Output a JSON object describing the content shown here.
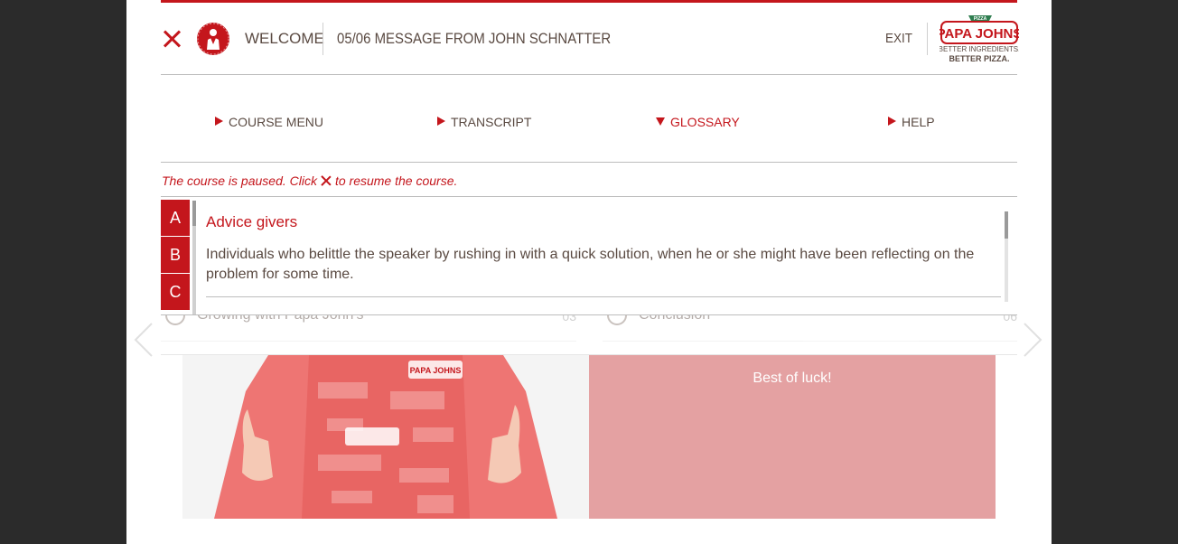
{
  "header": {
    "section_label": "WELCOME",
    "lesson_title": "05/06  MESSAGE FROM JOHN SCHNATTER",
    "exit_label": "EXIT",
    "logo": {
      "line1": "PAPA JOHNS",
      "line2": "BETTER INGREDIENTS.",
      "line3": "BETTER PIZZA.",
      "badge": "PIZZA"
    }
  },
  "nav": {
    "items": [
      {
        "label": "COURSE MENU",
        "state": "collapsed"
      },
      {
        "label": "TRANSCRIPT",
        "state": "collapsed"
      },
      {
        "label": "GLOSSARY",
        "state": "expanded"
      },
      {
        "label": "HELP",
        "state": "collapsed"
      }
    ]
  },
  "pause_notice": {
    "before": "The course is paused. Click",
    "after": "to resume the course."
  },
  "glossary": {
    "letters": [
      "A",
      "B",
      "C"
    ],
    "entry": {
      "term": "Advice givers",
      "definition": "Individuals who belittle the speaker by rushing in with a quick solution, when he or she might have been reflecting on the problem for some time."
    }
  },
  "course_menu": {
    "items": [
      {
        "label": "Growing with Papa John's",
        "number": "03"
      },
      {
        "label": "Conclusion",
        "number": "06"
      }
    ]
  },
  "content": {
    "quote": "Best of luck!",
    "apron_text": "PAPA JOHNS"
  },
  "colors": {
    "brand_red": "#c4161c",
    "text_brown": "#5a4a42",
    "quote_panel": "#e4a1a2",
    "backdrop": "#2b2b2b"
  }
}
